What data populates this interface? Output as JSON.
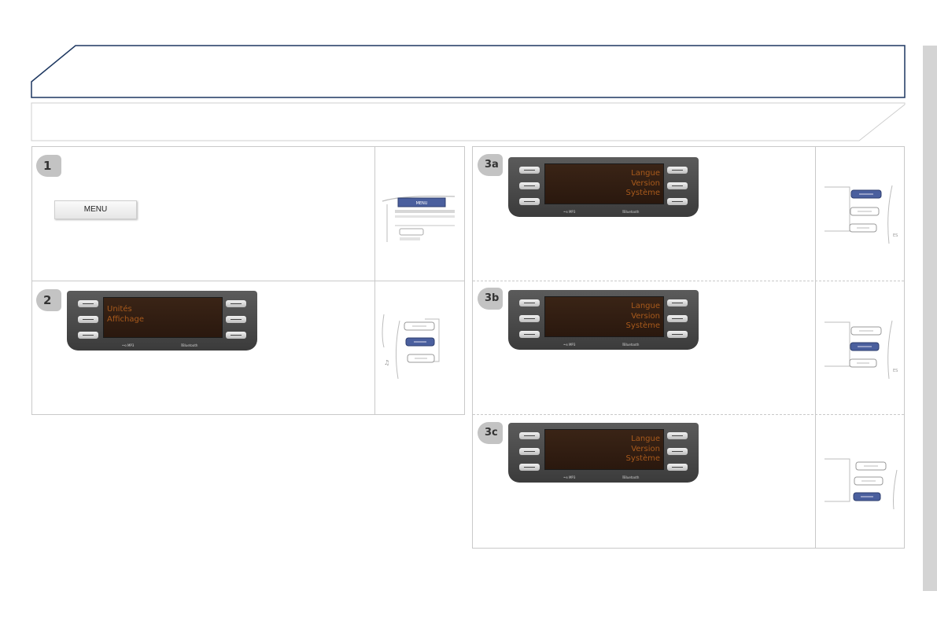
{
  "menu_button": {
    "label": "MENU"
  },
  "steps": {
    "s1": {
      "badge": "1"
    },
    "s2": {
      "badge": "2",
      "screen": [
        "Unités",
        "Affichage"
      ]
    },
    "s3a": {
      "badge": "3a",
      "screen": [
        "Langue",
        "Version",
        "Système"
      ]
    },
    "s3b": {
      "badge": "3b",
      "screen": [
        "Langue",
        "Version",
        "Système"
      ]
    },
    "s3c": {
      "badge": "3c",
      "screen": [
        "Langue",
        "Version",
        "Système"
      ]
    }
  },
  "radio_labels": {
    "usb": "•⟲ MP3",
    "bt": "⁑Bluetooth"
  },
  "illustration": {
    "menu_label": "MENU",
    "small_label": "ES"
  },
  "colors": {
    "frame_navy": "#1d3760",
    "highlight_blue": "#4a5f9e",
    "screen_text": "#a85a1c"
  }
}
